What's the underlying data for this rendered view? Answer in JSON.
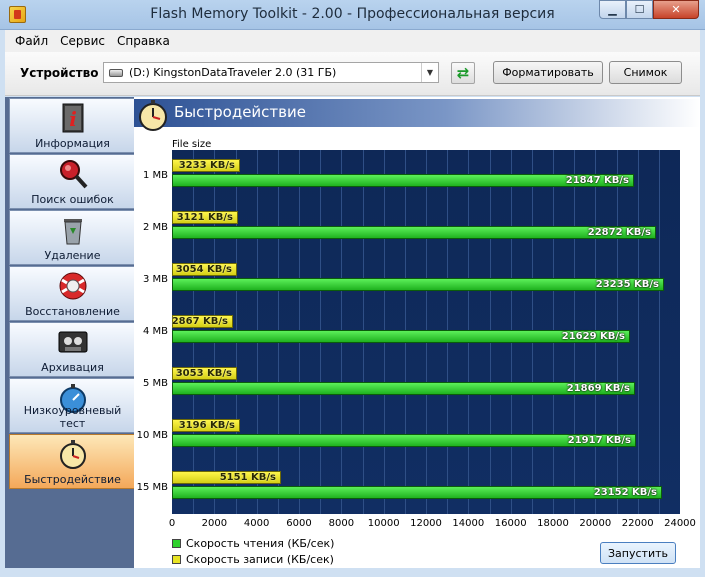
{
  "window": {
    "title": "Flash Memory Toolkit - 2.00 - Профессиональная версия",
    "controls": {
      "minimize": "▁",
      "maximize": "☐",
      "close": "✕"
    }
  },
  "menu": [
    "Файл",
    "Сервис",
    "Справка"
  ],
  "toolbar": {
    "device_label": "Устройство",
    "device_value": "(D:) KingstonDataTraveler 2.0 (31 ГБ)",
    "format_button": "Форматировать",
    "snapshot_button": "Снимок"
  },
  "sidebar": {
    "items": [
      {
        "label": "Информация",
        "icon": "info-icon"
      },
      {
        "label": "Поиск ошибок",
        "icon": "magnifier-icon"
      },
      {
        "label": "Удаление",
        "icon": "recycle-bin-icon"
      },
      {
        "label": "Восстановление",
        "icon": "lifebuoy-icon"
      },
      {
        "label": "Архивация",
        "icon": "tape-icon"
      },
      {
        "label": "Низкоуровневый тест",
        "icon": "stopwatch-icon"
      },
      {
        "label": "Быстродействие",
        "icon": "clock-icon",
        "active": true
      }
    ]
  },
  "page": {
    "title": "Быстродействие",
    "run_button": "Запустить"
  },
  "chart_data": {
    "type": "bar",
    "orientation": "horizontal",
    "ylabel": "File size",
    "categories": [
      "1 MB",
      "2 MB",
      "3 MB",
      "4 MB",
      "5 MB",
      "10 MB",
      "15 MB"
    ],
    "series": [
      {
        "name": "Скорость записи (КБ/сек)",
        "values": [
          3233,
          3121,
          3054,
          2867,
          3053,
          3196,
          5151
        ],
        "labels": [
          "3233 KB/s",
          "3121 KB/s",
          "3054 KB/s",
          "2867 KB/s",
          "3053 KB/s",
          "3196 KB/s",
          "5151 KB/s"
        ],
        "color": "#e8e424"
      },
      {
        "name": "Скорость чтения (КБ/сек)",
        "values": [
          21847,
          22872,
          23235,
          21629,
          21869,
          21917,
          23152
        ],
        "labels": [
          "21847 KB/s",
          "22872 KB/s",
          "23235 KB/s",
          "21629 KB/s",
          "21869 KB/s",
          "21917 KB/s",
          "23152 KB/s"
        ],
        "color": "#2fd12d"
      }
    ],
    "xlim": [
      0,
      24000
    ],
    "xticks": [
      "0",
      "2000",
      "4000",
      "6000",
      "8000",
      "10000",
      "12000",
      "14000",
      "16000",
      "18000",
      "20000",
      "22000",
      "24000"
    ],
    "grid": true,
    "legend": [
      {
        "name": "Скорость чтения (КБ/сек)",
        "color": "#2fd12d"
      },
      {
        "name": "Скорость записи (КБ/сек)",
        "color": "#e8e424"
      }
    ],
    "legend_placement": "bottom-left"
  }
}
